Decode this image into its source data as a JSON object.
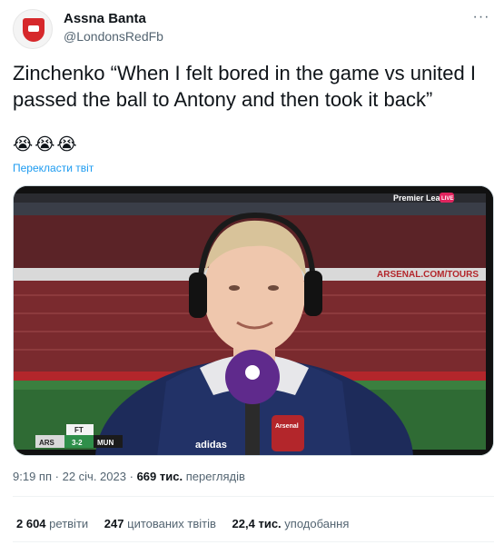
{
  "author": {
    "name": "Assna Banta",
    "handle": "@LondonsRedFb",
    "avatar_icon": "arsenal-crest-icon"
  },
  "tweet": {
    "text": "Zinchenko  “When I felt bored in the game vs united I passed the ball to Antony and then took it back”",
    "emojis": "😭😭😭",
    "translate_label": "Перекласти твіт"
  },
  "media": {
    "broadcaster": "Premier League",
    "live_badge": "LIVE",
    "board_text": "ARSENAL.COM/TOURS",
    "score_status": "FT",
    "home_team": "ARS",
    "away_team": "MUN",
    "score": "3-2",
    "shirt_brand": "adidas",
    "shirt_club": "Arsenal"
  },
  "meta": {
    "time": "9:19 пп",
    "date": "22 січ. 2023",
    "separator": "·",
    "views_count": "669 тис.",
    "views_label": "переглядів"
  },
  "stats": {
    "retweets_count": "2 604",
    "retweets_label": "ретвіти",
    "quotes_count": "247",
    "quotes_label": "цитованих твітів",
    "likes_count": "22,4 тис.",
    "likes_label": "уподобання"
  },
  "colors": {
    "link": "#1d9bf0",
    "muted": "#536471",
    "crest": "#d6282b"
  }
}
